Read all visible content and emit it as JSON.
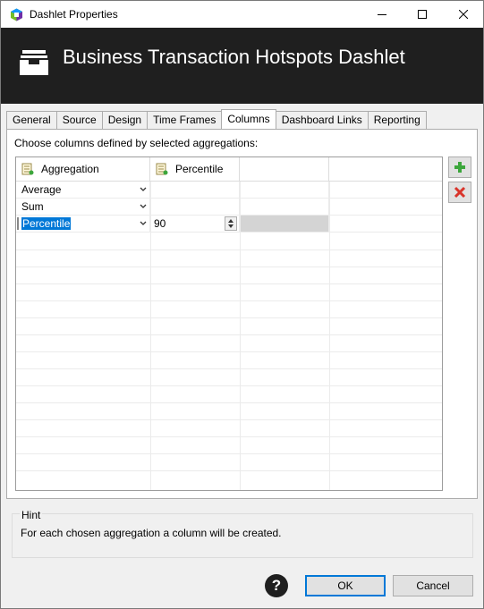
{
  "window": {
    "title": "Dashlet Properties",
    "header_title": "Business Transaction Hotspots Dashlet"
  },
  "tabs": [
    {
      "label": "General"
    },
    {
      "label": "Source"
    },
    {
      "label": "Design"
    },
    {
      "label": "Time Frames"
    },
    {
      "label": "Columns",
      "active": true
    },
    {
      "label": "Dashboard Links"
    },
    {
      "label": "Reporting"
    }
  ],
  "columns_panel": {
    "instruction": "Choose columns defined by selected aggregations:",
    "headers": [
      "Aggregation",
      "Percentile"
    ],
    "rows": [
      {
        "aggregation": "Average",
        "percentile": ""
      },
      {
        "aggregation": "Sum",
        "percentile": ""
      },
      {
        "aggregation": "Percentile",
        "percentile": "90"
      }
    ]
  },
  "hint": {
    "title": "Hint",
    "text": "For each chosen aggregation a column will be created."
  },
  "buttons": {
    "help": "?",
    "ok": "OK",
    "cancel": "Cancel"
  },
  "icons": {
    "app": "dynatrace-logo-icon",
    "header": "inbox-tray-icon",
    "add": "plus-icon",
    "remove": "x-icon"
  },
  "colors": {
    "header_bg": "#1f1f1f",
    "selection": "#0078d7",
    "add_icon": "#3ca63c",
    "remove_icon": "#d9342b"
  }
}
